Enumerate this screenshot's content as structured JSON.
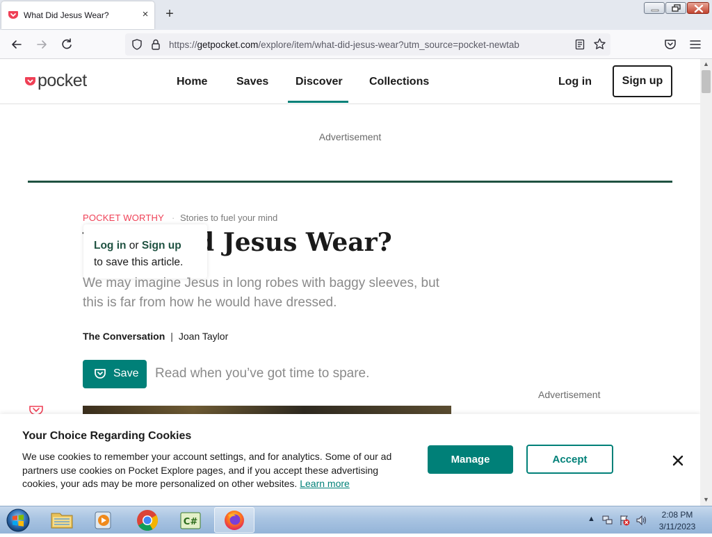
{
  "browser": {
    "tab_title": "What Did Jesus Wear?",
    "tab_close": "×",
    "new_tab": "+",
    "url_prefix": "https://",
    "url_domain": "getpocket.com",
    "url_path": "/explore/item/what-did-jesus-wear?utm_source=pocket-newtab"
  },
  "site_header": {
    "logo_text": "pocket",
    "nav": [
      "Home",
      "Saves",
      "Discover",
      "Collections"
    ],
    "active_nav": "Discover",
    "login": "Log in",
    "signup": "Sign up"
  },
  "ads": {
    "top_label": "Advertisement",
    "side_label": "Advertisement"
  },
  "article": {
    "kicker": "POCKET WORTHY",
    "kicker_sep": "·",
    "kicker_tagline": "Stories to fuel your mind",
    "title": "What Did Jesus Wear?",
    "excerpt": "We may imagine Jesus in long robes with baggy sleeves, but this is far from how he would have dressed.",
    "publisher": "The Conversation",
    "byline_sep": "|",
    "author": "Joan Taylor",
    "save_label": "Save",
    "save_tagline": "Read when you’ve got time to spare."
  },
  "popover": {
    "login": "Log in",
    "or": " or ",
    "signup": "Sign up",
    "line2": "to save this article."
  },
  "cookie_banner": {
    "title": "Your Choice Regarding Cookies",
    "body": "We use cookies to remember your account settings, and for analytics. Some of our ad partners use cookies on Pocket Explore pages, and if you accept these advertising cookies, your ads may be more personalized on other websites. ",
    "learn_more": "Learn more",
    "manage": "Manage",
    "accept": "Accept"
  },
  "taskbar": {
    "apps": [
      "windows-explorer",
      "windows-media-player",
      "google-chrome",
      "csharp-ide",
      "firefox"
    ],
    "active_app": "firefox",
    "time": "2:08 PM",
    "date": "3/11/2023"
  },
  "colors": {
    "brand_red": "#ef4056",
    "brand_teal": "#008078",
    "dark_green": "#1f5241"
  }
}
